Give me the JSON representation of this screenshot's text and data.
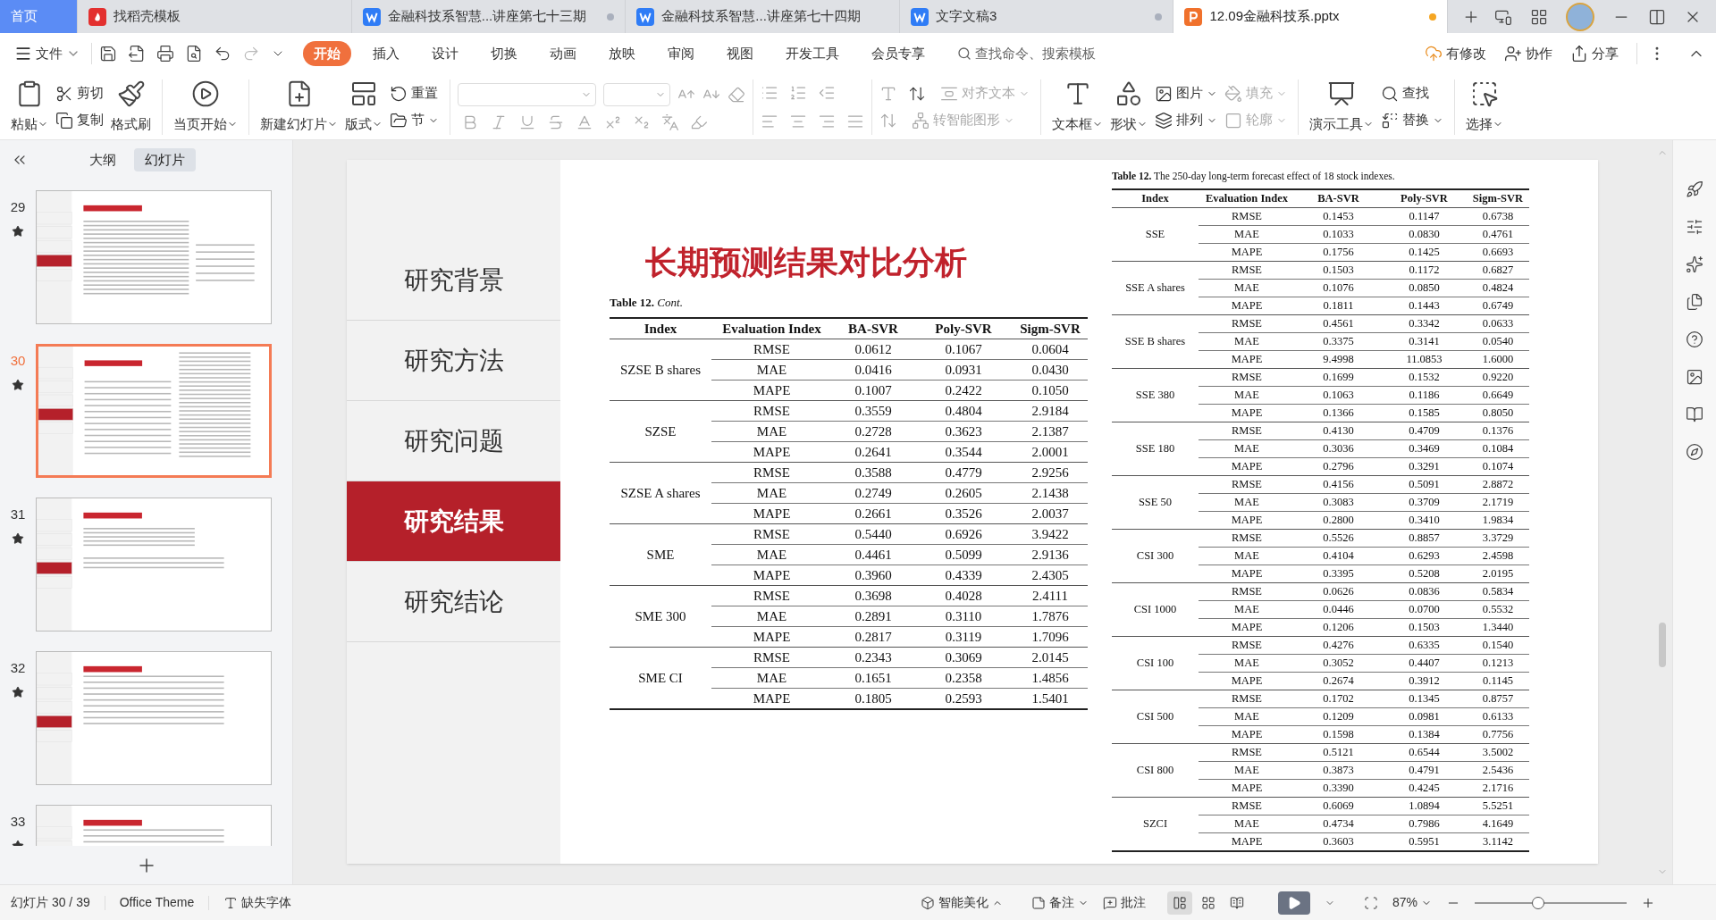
{
  "tabs": [
    {
      "label": "首页",
      "kind": "home",
      "selected": true,
      "unsaved": false
    },
    {
      "label": "找稻壳模板",
      "kind": "template",
      "selected": false,
      "unsaved": false
    },
    {
      "label": "金融科技系智慧...讲座第七十三期",
      "kind": "writer",
      "selected": false,
      "unsaved": true
    },
    {
      "label": "金融科技系智慧...讲座第七十四期",
      "kind": "writer",
      "selected": false,
      "unsaved": false
    },
    {
      "label": "文字文稿3",
      "kind": "writer",
      "selected": false,
      "unsaved": true
    },
    {
      "label": "12.09金融科技系.pptx",
      "kind": "presentation",
      "selected": true,
      "unsaved": true
    }
  ],
  "menu": {
    "file": "文件",
    "tabs": [
      {
        "label": "开始",
        "selected": true
      },
      {
        "label": "插入",
        "selected": false
      },
      {
        "label": "设计",
        "selected": false
      },
      {
        "label": "切换",
        "selected": false
      },
      {
        "label": "动画",
        "selected": false
      },
      {
        "label": "放映",
        "selected": false
      },
      {
        "label": "审阅",
        "selected": false
      },
      {
        "label": "视图",
        "selected": false
      },
      {
        "label": "开发工具",
        "selected": false
      },
      {
        "label": "会员专享",
        "selected": false
      }
    ],
    "search": {
      "placeholder": "查找命令、搜索模板"
    },
    "actions": [
      "有修改",
      "协作",
      "分享"
    ]
  },
  "ribbon": {
    "paste": "粘贴",
    "cut": "剪切",
    "copy": "复制",
    "format_painter": "格式刷",
    "play_current": "当页开始",
    "new_slide": "新建幻灯片",
    "layout": "版式",
    "reset": "重置",
    "section": "节",
    "align_text": {
      "label": "对齐文本",
      "disabled": true
    },
    "smart_art": {
      "label": "转智能图形",
      "disabled": true
    },
    "text_box": "文本框",
    "shape": "形状",
    "picture": "图片",
    "arrange": "排列",
    "fill": {
      "label": "填充",
      "disabled": true
    },
    "outline": {
      "label": "轮廓",
      "disabled": true
    },
    "tools": "演示工具",
    "find": "查找",
    "replace": "替换",
    "select": "选择"
  },
  "panel": {
    "tabs": [
      {
        "label": "大纲",
        "selected": false
      },
      {
        "label": "幻灯片",
        "selected": true
      }
    ],
    "slides": [
      {
        "number": "29",
        "kind": "table-text",
        "selected": false
      },
      {
        "number": "30",
        "kind": "two-tables",
        "selected": true
      },
      {
        "number": "31",
        "kind": "small-table",
        "selected": false
      },
      {
        "number": "32",
        "kind": "text",
        "selected": false
      },
      {
        "number": "33",
        "kind": "text",
        "selected": false
      }
    ]
  },
  "slide": {
    "nav": [
      {
        "label": "研究背景",
        "selected": false
      },
      {
        "label": "研究方法",
        "selected": false
      },
      {
        "label": "研究问题",
        "selected": false
      },
      {
        "label": "研究结果",
        "selected": true
      },
      {
        "label": "研究结论",
        "selected": false
      }
    ],
    "title": "长期预测结果对比分析",
    "left_table": {
      "caption": "**Table 12.** *Cont.*",
      "columns": [
        "Index",
        "Evaluation Index",
        "BA-SVR",
        "Poly-SVR",
        "Sigm-SVR"
      ],
      "groups": [
        {
          "index": "SZSE B shares",
          "rows": [
            [
              "RMSE",
              "0.0612",
              "0.1067",
              "0.0604"
            ],
            [
              "MAE",
              "0.0416",
              "0.0931",
              "0.0430"
            ],
            [
              "MAPE",
              "0.1007",
              "0.2422",
              "0.1050"
            ]
          ]
        },
        {
          "index": "SZSE",
          "rows": [
            [
              "RMSE",
              "0.3559",
              "0.4804",
              "2.9184"
            ],
            [
              "MAE",
              "0.2728",
              "0.3623",
              "2.1387"
            ],
            [
              "MAPE",
              "0.2641",
              "0.3544",
              "2.0001"
            ]
          ]
        },
        {
          "index": "SZSE A shares",
          "rows": [
            [
              "RMSE",
              "0.3588",
              "0.4779",
              "2.9256"
            ],
            [
              "MAE",
              "0.2749",
              "0.2605",
              "2.1438"
            ],
            [
              "MAPE",
              "0.2661",
              "0.3526",
              "2.0037"
            ]
          ]
        },
        {
          "index": "SME",
          "rows": [
            [
              "RMSE",
              "0.5440",
              "0.6926",
              "3.9422"
            ],
            [
              "MAE",
              "0.4461",
              "0.5099",
              "2.9136"
            ],
            [
              "MAPE",
              "0.3960",
              "0.4339",
              "2.4305"
            ]
          ]
        },
        {
          "index": "SME 300",
          "rows": [
            [
              "RMSE",
              "0.3698",
              "0.4028",
              "2.4111"
            ],
            [
              "MAE",
              "0.2891",
              "0.3110",
              "1.7876"
            ],
            [
              "MAPE",
              "0.2817",
              "0.3119",
              "1.7096"
            ]
          ]
        },
        {
          "index": "SME CI",
          "rows": [
            [
              "RMSE",
              "0.2343",
              "0.3069",
              "2.0145"
            ],
            [
              "MAE",
              "0.1651",
              "0.2358",
              "1.4856"
            ],
            [
              "MAPE",
              "0.1805",
              "0.2593",
              "1.5401"
            ]
          ]
        }
      ]
    },
    "right_table": {
      "caption": "**Table 12.** The 250-day long-term forecast effect of 18 stock indexes.",
      "columns": [
        "Index",
        "Evaluation Index",
        "BA-SVR",
        "Poly-SVR",
        "Sigm-SVR"
      ],
      "groups": [
        {
          "index": "SSE",
          "rows": [
            [
              "RMSE",
              "0.1453",
              "0.1147",
              "0.6738"
            ],
            [
              "MAE",
              "0.1033",
              "0.0830",
              "0.4761"
            ],
            [
              "MAPE",
              "0.1756",
              "0.1425",
              "0.6693"
            ]
          ]
        },
        {
          "index": "SSE A shares",
          "rows": [
            [
              "RMSE",
              "0.1503",
              "0.1172",
              "0.6827"
            ],
            [
              "MAE",
              "0.1076",
              "0.0850",
              "0.4824"
            ],
            [
              "MAPE",
              "0.1811",
              "0.1443",
              "0.6749"
            ]
          ]
        },
        {
          "index": "SSE B shares",
          "rows": [
            [
              "RMSE",
              "0.4561",
              "0.3342",
              "0.0633"
            ],
            [
              "MAE",
              "0.3375",
              "0.3141",
              "0.0540"
            ],
            [
              "MAPE",
              "9.4998",
              "11.0853",
              "1.6000"
            ]
          ]
        },
        {
          "index": "SSE 380",
          "rows": [
            [
              "RMSE",
              "0.1699",
              "0.1532",
              "0.9220"
            ],
            [
              "MAE",
              "0.1063",
              "0.1186",
              "0.6649"
            ],
            [
              "MAPE",
              "0.1366",
              "0.1585",
              "0.8050"
            ]
          ]
        },
        {
          "index": "SSE 180",
          "rows": [
            [
              "RMSE",
              "0.4130",
              "0.4709",
              "0.1376"
            ],
            [
              "MAE",
              "0.3036",
              "0.3469",
              "0.1084"
            ],
            [
              "MAPE",
              "0.2796",
              "0.3291",
              "0.1074"
            ]
          ]
        },
        {
          "index": "SSE 50",
          "rows": [
            [
              "RMSE",
              "0.4156",
              "0.5091",
              "2.8872"
            ],
            [
              "MAE",
              "0.3083",
              "0.3709",
              "2.1719"
            ],
            [
              "MAPE",
              "0.2800",
              "0.3410",
              "1.9834"
            ]
          ]
        },
        {
          "index": "CSI 300",
          "rows": [
            [
              "RMSE",
              "0.5526",
              "0.8857",
              "3.3729"
            ],
            [
              "MAE",
              "0.4104",
              "0.6293",
              "2.4598"
            ],
            [
              "MAPE",
              "0.3395",
              "0.5208",
              "2.0195"
            ]
          ]
        },
        {
          "index": "CSI 1000",
          "rows": [
            [
              "RMSE",
              "0.0626",
              "0.0836",
              "0.5834"
            ],
            [
              "MAE",
              "0.0446",
              "0.0700",
              "0.5532"
            ],
            [
              "MAPE",
              "0.1206",
              "0.1503",
              "1.3440"
            ]
          ]
        },
        {
          "index": "CSI 100",
          "rows": [
            [
              "RMSE",
              "0.4276",
              "0.6335",
              "0.1540"
            ],
            [
              "MAE",
              "0.3052",
              "0.4407",
              "0.1213"
            ],
            [
              "MAPE",
              "0.2674",
              "0.3912",
              "0.1145"
            ]
          ]
        },
        {
          "index": "CSI 500",
          "rows": [
            [
              "RMSE",
              "0.1702",
              "0.1345",
              "0.8757"
            ],
            [
              "MAE",
              "0.1209",
              "0.0981",
              "0.6133"
            ],
            [
              "MAPE",
              "0.1598",
              "0.1384",
              "0.7756"
            ]
          ]
        },
        {
          "index": "CSI 800",
          "rows": [
            [
              "RMSE",
              "0.5121",
              "0.6544",
              "3.5002"
            ],
            [
              "MAE",
              "0.3873",
              "0.4791",
              "2.5436"
            ],
            [
              "MAPE",
              "0.3390",
              "0.4245",
              "2.1716"
            ]
          ]
        },
        {
          "index": "SZCI",
          "rows": [
            [
              "RMSE",
              "0.6069",
              "1.0894",
              "5.5251"
            ],
            [
              "MAE",
              "0.4734",
              "0.7986",
              "4.1649"
            ],
            [
              "MAPE",
              "0.3603",
              "0.5951",
              "3.1142"
            ]
          ]
        }
      ]
    }
  },
  "status": {
    "slide_counter": "幻灯片 30 / 39",
    "theme": "Office Theme",
    "missing_fonts": "缺失字体",
    "beautify": "智能美化",
    "notes": "备注",
    "comments": "批注",
    "views": [
      {
        "kind": "normal",
        "selected": true
      },
      {
        "kind": "sorter",
        "selected": false
      },
      {
        "kind": "reading",
        "selected": false
      }
    ],
    "zoom": "87%",
    "zoom_slider": {
      "level": 0.42
    }
  }
}
